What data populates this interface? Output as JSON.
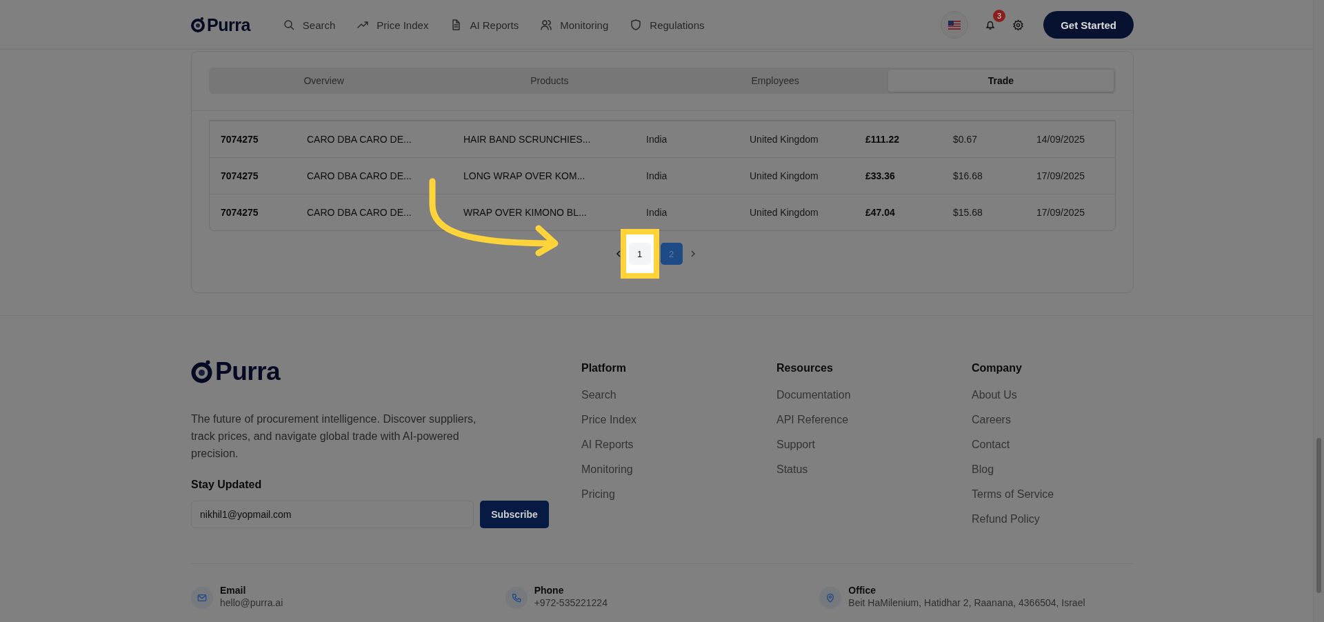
{
  "header": {
    "logo": "Purra",
    "nav": [
      {
        "label": "Search"
      },
      {
        "label": "Price Index"
      },
      {
        "label": "AI Reports"
      },
      {
        "label": "Monitoring"
      },
      {
        "label": "Regulations"
      }
    ],
    "notification_count": "3",
    "cta": "Get Started"
  },
  "tabs": [
    {
      "label": "Overview",
      "selected": false
    },
    {
      "label": "Products",
      "selected": false
    },
    {
      "label": "Employees",
      "selected": false
    },
    {
      "label": "Trade",
      "selected": true
    }
  ],
  "table": {
    "rows": [
      [
        "7074275",
        "CARO DBA CARO DE...",
        "HAIR BAND SCRUNCHIES...",
        "India",
        "United Kingdom",
        "£111.22",
        "$0.67",
        "14/09/2025"
      ],
      [
        "7074275",
        "CARO DBA CARO DE...",
        "LONG WRAP OVER KOM...",
        "India",
        "United Kingdom",
        "£33.36",
        "$16.68",
        "17/09/2025"
      ],
      [
        "7074275",
        "CARO DBA CARO DE...",
        "WRAP OVER KIMONO BL...",
        "India",
        "United Kingdom",
        "£47.04",
        "$15.68",
        "17/09/2025"
      ]
    ]
  },
  "pagination": {
    "pages": [
      {
        "label": "1",
        "selected": false,
        "highlighted": true
      },
      {
        "label": "2",
        "selected": true,
        "highlighted": false
      }
    ]
  },
  "footer": {
    "logo": "Purra",
    "description": "The future of procurement intelligence. Discover suppliers, track prices, and navigate global trade with AI-powered precision.",
    "newsletter": {
      "title": "Stay Updated",
      "value": "nikhil1@yopmail.com",
      "button": "Subscribe"
    },
    "columns": [
      {
        "title": "Platform",
        "links": [
          "Search",
          "Price Index",
          "AI Reports",
          "Monitoring",
          "Pricing"
        ]
      },
      {
        "title": "Resources",
        "links": [
          "Documentation",
          "API Reference",
          "Support",
          "Status"
        ]
      },
      {
        "title": "Company",
        "links": [
          "About Us",
          "Careers",
          "Contact",
          "Blog",
          "Terms of Service",
          "Refund Policy"
        ]
      }
    ],
    "contacts": [
      {
        "kind": "email",
        "label": "Email",
        "value": "hello@purra.ai"
      },
      {
        "kind": "phone",
        "label": "Phone",
        "value": "+972-535221224"
      },
      {
        "kind": "office",
        "label": "Office",
        "value": "Beit HaMilenium, Hatidhar 2, Raanana, 4366504, Israel"
      }
    ]
  }
}
